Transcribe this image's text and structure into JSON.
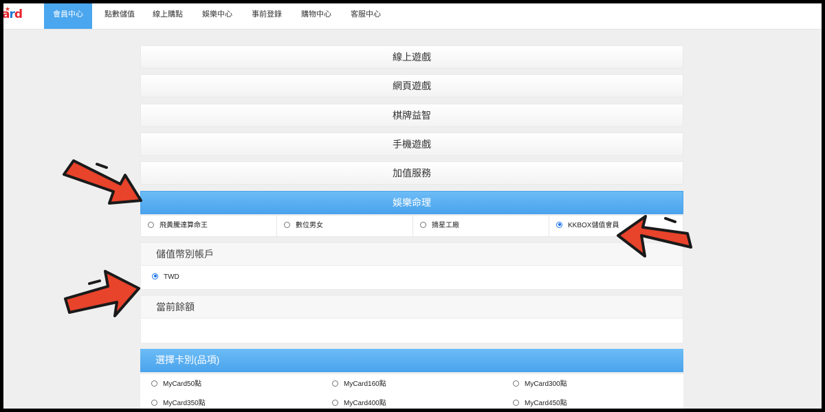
{
  "nav": {
    "logo_text": "ard",
    "items": [
      {
        "label": "會員中心",
        "active": true
      },
      {
        "label": "點數儲值",
        "active": false
      },
      {
        "label": "線上購點",
        "active": false
      },
      {
        "label": "娛樂中心",
        "active": false
      },
      {
        "label": "事前登錄",
        "active": false
      },
      {
        "label": "購物中心",
        "active": false
      },
      {
        "label": "客服中心",
        "active": false
      }
    ]
  },
  "categories": [
    {
      "label": "線上遊戲",
      "active": false
    },
    {
      "label": "網頁遊戲",
      "active": false
    },
    {
      "label": "棋牌益智",
      "active": false
    },
    {
      "label": "手機遊戲",
      "active": false
    },
    {
      "label": "加值服務",
      "active": false
    },
    {
      "label": "娛樂命理",
      "active": true
    }
  ],
  "subitems": [
    {
      "label": "飛黃騰達算命王",
      "selected": false
    },
    {
      "label": "數位男女",
      "selected": false
    },
    {
      "label": "摘星工廠",
      "selected": false
    },
    {
      "label": "KKBOX儲值會員",
      "selected": true
    }
  ],
  "currency": {
    "title": "儲值幣別帳戶",
    "option": "TWD",
    "selected": true
  },
  "balance": {
    "title": "當前餘額",
    "value": ""
  },
  "card_select": {
    "title": "選擇卡別(品項)",
    "options": [
      "MyCard50點",
      "MyCard160點",
      "MyCard300點",
      "MyCard350點",
      "MyCard400點",
      "MyCard450點"
    ]
  },
  "colors": {
    "accent": "#4aa6ee",
    "arrow": "#e8432b"
  }
}
